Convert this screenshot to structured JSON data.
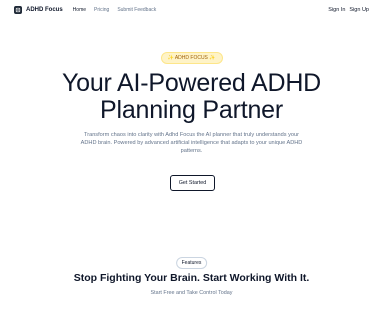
{
  "header": {
    "brand": "ADHD Focus",
    "nav": [
      "Home",
      "Pricing",
      "Submit Feedback"
    ],
    "sign_in": "Sign In",
    "sign_up": "Sign Up"
  },
  "hero": {
    "badge": "✨ ADHD FOCUS ✨",
    "title_line1": "Your AI-Powered ADHD",
    "title_line2": "Planning Partner",
    "subtitle": "Transform chaos into clarity with Adhd Focus the AI planner that truly understands your ADHD brain. Powered by advanced artificial intelligence that adapts to your unique ADHD patterns.",
    "cta_label": "Get Started"
  },
  "features": {
    "pill": "Features",
    "title": "Stop Fighting Your Brain. Start Working With It.",
    "subtitle": "Start Free and Take Control Today"
  }
}
